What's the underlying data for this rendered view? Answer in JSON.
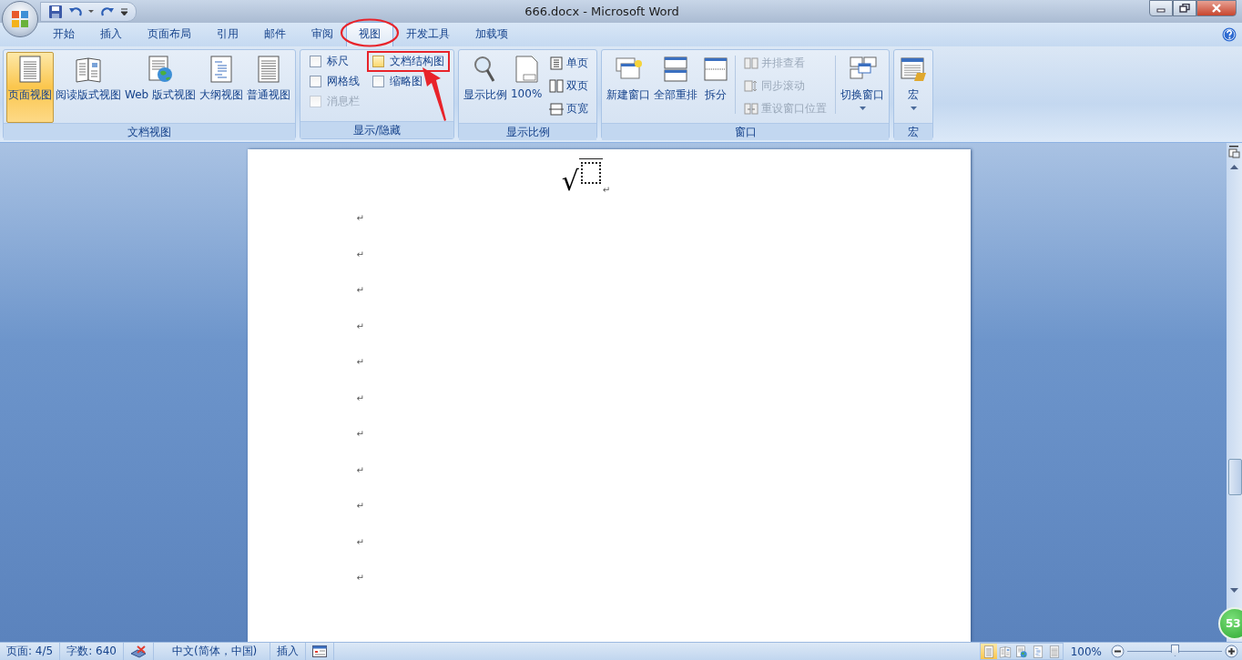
{
  "window": {
    "title": "666.docx - Microsoft Word"
  },
  "tabs": [
    {
      "label": "开始",
      "selected": false,
      "circled": false
    },
    {
      "label": "插入",
      "selected": false,
      "circled": false
    },
    {
      "label": "页面布局",
      "selected": false,
      "circled": false
    },
    {
      "label": "引用",
      "selected": false,
      "circled": false
    },
    {
      "label": "邮件",
      "selected": false,
      "circled": false
    },
    {
      "label": "审阅",
      "selected": false,
      "circled": false
    },
    {
      "label": "视图",
      "selected": true,
      "circled": true
    },
    {
      "label": "开发工具",
      "selected": false,
      "circled": false
    },
    {
      "label": "加载项",
      "selected": false,
      "circled": false
    }
  ],
  "ribbon": {
    "groups": [
      {
        "kind": "views",
        "label": "文档视图",
        "buttons": [
          {
            "kind": "print",
            "label": "页面视图",
            "selected": true
          },
          {
            "kind": "reading",
            "label": "阅读版式视图",
            "selected": false
          },
          {
            "kind": "web",
            "label": "Web 版式视图",
            "selected": false
          },
          {
            "kind": "outline",
            "label": "大纲视图",
            "selected": false
          },
          {
            "kind": "draft",
            "label": "普通视图",
            "selected": false
          }
        ]
      },
      {
        "kind": "checks",
        "label": "显示/隐藏",
        "items": [
          {
            "label": "标尺",
            "checked": false,
            "disabled": false,
            "highlighted": false
          },
          {
            "label": "网格线",
            "checked": false,
            "disabled": false,
            "highlighted": false
          },
          {
            "label": "消息栏",
            "checked": false,
            "disabled": true,
            "highlighted": false
          },
          {
            "label": "文档结构图",
            "checked": false,
            "disabled": false,
            "highlighted": true
          },
          {
            "label": "缩略图",
            "checked": false,
            "disabled": false,
            "highlighted": false
          }
        ]
      },
      {
        "kind": "zoom",
        "label": "显示比例",
        "large": [
          {
            "kind": "zoom",
            "label": "显示比例"
          },
          {
            "kind": "hundred",
            "label": "100%"
          }
        ],
        "small": [
          {
            "kind": "one",
            "label": "单页"
          },
          {
            "kind": "two",
            "label": "双页"
          },
          {
            "kind": "width",
            "label": "页宽"
          }
        ]
      },
      {
        "kind": "window",
        "label": "窗口",
        "large": [
          {
            "kind": "new",
            "label": "新建窗口"
          },
          {
            "kind": "arrange",
            "label": "全部重排"
          },
          {
            "kind": "split",
            "label": "拆分"
          }
        ],
        "small": [
          {
            "kind": "side",
            "label": "并排查看",
            "disabled": true
          },
          {
            "kind": "sync",
            "label": "同步滚动",
            "disabled": true
          },
          {
            "kind": "reset",
            "label": "重设窗口位置",
            "disabled": true
          }
        ],
        "menu": {
          "kind": "switch",
          "label": "切换窗口"
        }
      },
      {
        "kind": "macro",
        "label": "宏",
        "menu": {
          "kind": "macro",
          "label": "宏"
        }
      }
    ]
  },
  "document": {
    "equation": {
      "symbol": "√",
      "mark": "↵"
    },
    "paragraph_marks": [
      "↵",
      "↵",
      "↵",
      "↵",
      "↵",
      "↵",
      "↵",
      "↵",
      "↵",
      "↵",
      "↵"
    ]
  },
  "floating_badge": "53",
  "status_bar": {
    "page": "页面: 4/5",
    "words": "字数: 640",
    "language": "中文(简体，中国)",
    "mode": "插入",
    "view_buttons": [
      {
        "kind": "print",
        "selected": true
      },
      {
        "kind": "reading",
        "selected": false
      },
      {
        "kind": "web",
        "selected": false
      },
      {
        "kind": "outline",
        "selected": false
      },
      {
        "kind": "draft",
        "selected": false
      }
    ],
    "zoom": "100%",
    "zoom_slider": {
      "level": 0.5
    }
  }
}
